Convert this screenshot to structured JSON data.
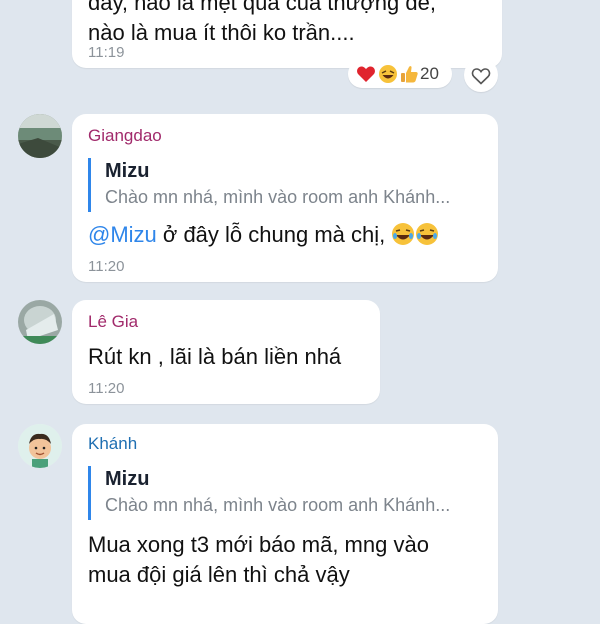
{
  "messages": [
    {
      "text": "đây, nào là mệt quá của thượng đế,\nnào là mua ít thôi ko trần....",
      "time": "11:19",
      "reactions": {
        "count": "20"
      }
    },
    {
      "sender": "Giangdao",
      "sender_color": "#a12a6b",
      "quote": {
        "name": "Mizu",
        "text": "Chào mn nhá, mình vào room anh Khánh..."
      },
      "mention": "@Mizu",
      "text": " ở đây lỗ chung mà chị, ",
      "time": "11:20"
    },
    {
      "sender": "Lê Gia",
      "sender_color": "#a12a6b",
      "text": "Rút kn , lãi là bán liền nhá",
      "time": "11:20"
    },
    {
      "sender": "Khánh",
      "sender_color": "#1f6fb2",
      "quote": {
        "name": "Mizu",
        "text": "Chào mn nhá, mình vào room anh Khánh..."
      },
      "text": "Mua xong t3 mới báo mã, mng vào\nmua đội giá lên thì chả vậy"
    }
  ]
}
